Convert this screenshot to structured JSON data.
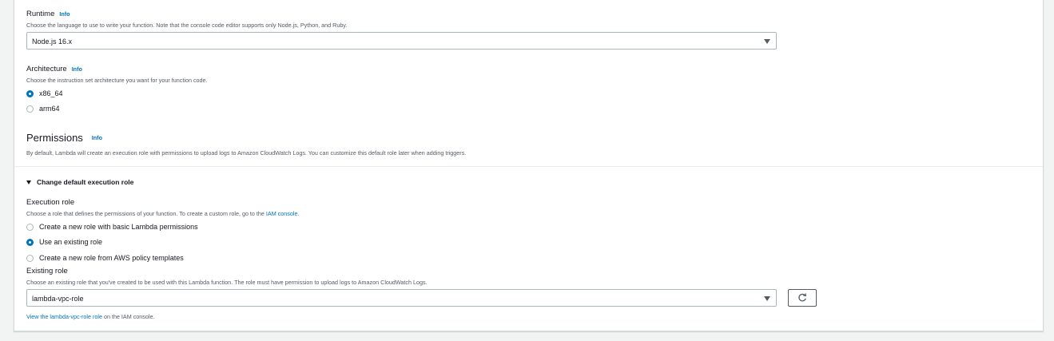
{
  "runtime": {
    "label": "Runtime",
    "info": "Info",
    "description": "Choose the language to use to write your function. Note that the console code editor supports only Node.js, Python, and Ruby.",
    "selected": "Node.js 16.x"
  },
  "architecture": {
    "label": "Architecture",
    "info": "Info",
    "description": "Choose the instruction set architecture you want for your function code.",
    "options": [
      {
        "label": "x86_64",
        "checked": true
      },
      {
        "label": "arm64",
        "checked": false
      }
    ]
  },
  "permissions": {
    "title": "Permissions",
    "info": "Info",
    "description": "By default, Lambda will create an execution role with permissions to upload logs to Amazon CloudWatch Logs. You can customize this default role later when adding triggers."
  },
  "change_role": {
    "label": "Change default execution role"
  },
  "execution_role": {
    "label": "Execution role",
    "description_prefix": "Choose a role that defines the permissions of your function. To create a custom role, go to the",
    "description_link": "IAM console",
    "description_suffix": ".",
    "options": [
      {
        "label": "Create a new role with basic Lambda permissions",
        "checked": false
      },
      {
        "label": "Use an existing role",
        "checked": true
      },
      {
        "label": "Create a new role from AWS policy templates",
        "checked": false
      }
    ]
  },
  "existing_role": {
    "label": "Existing role",
    "description": "Choose an existing role that you've created to be used with this Lambda function. The role must have permission to upload logs to Amazon CloudWatch Logs.",
    "selected": "lambda-vpc-role",
    "view_link_prefix": "View the lambda-vpc-role role",
    "view_link_suffix": " on the IAM console."
  },
  "icons": {
    "refresh": "refresh-icon",
    "caret": "caret-down-icon",
    "expander": "triangle-down-icon"
  },
  "colors": {
    "accent": "#0073bb",
    "page_bg": "#f2f3f3",
    "panel_bg": "#ffffff",
    "text": "#16191f",
    "muted": "#545b64"
  }
}
